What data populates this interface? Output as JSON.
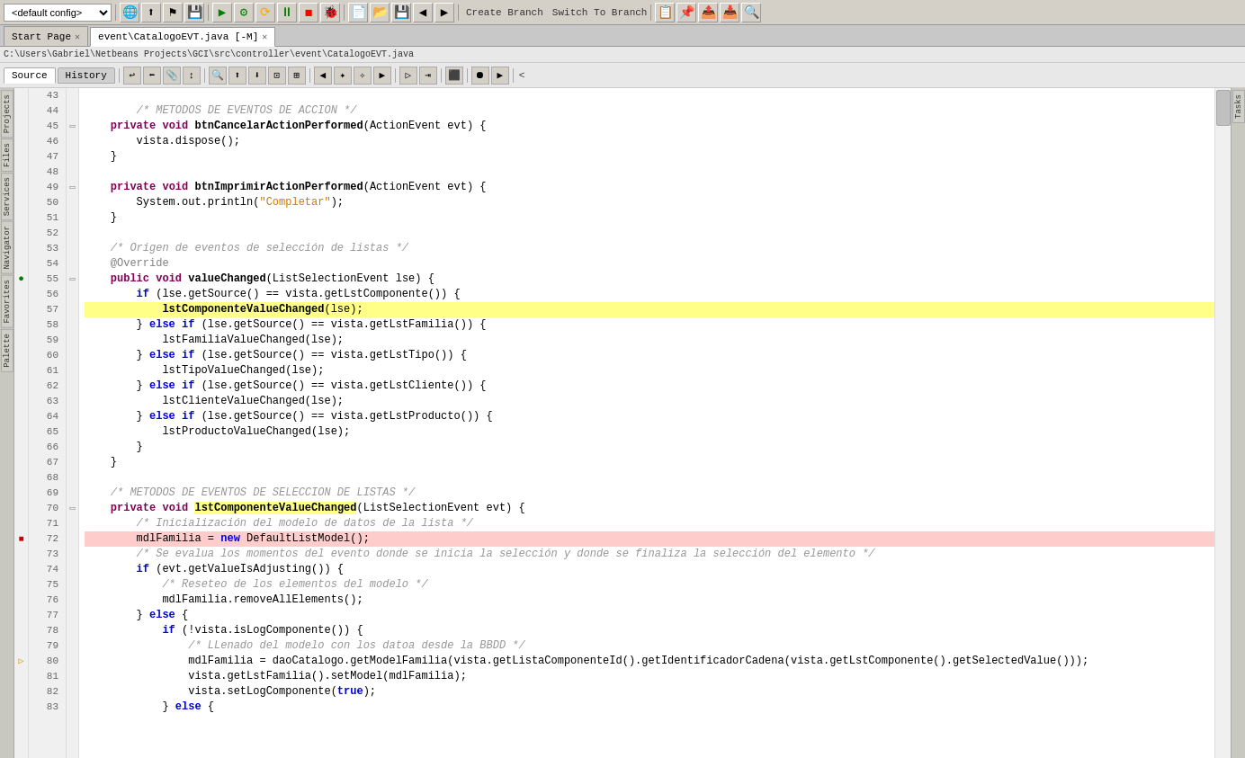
{
  "toolbar": {
    "config_dropdown": "<default config>",
    "buttons": [
      "globe",
      "↑",
      "⛳",
      "💾",
      "▶",
      "⬡",
      "⟳",
      "⏸",
      "◼",
      "📋",
      "📄",
      "💻",
      "📑",
      "🔧"
    ]
  },
  "tabs": [
    {
      "label": "Start Page",
      "active": false,
      "closeable": true
    },
    {
      "label": "event\\CatalogoEVT.java [-M]",
      "active": true,
      "closeable": true
    }
  ],
  "breadcrumb": "C:\\Users\\Gabriel\\Netbeans Projects\\GCI\\src\\controller\\event\\CatalogoEVT.java",
  "source_tabs": [
    {
      "label": "Source",
      "active": true
    },
    {
      "label": "History",
      "active": false
    }
  ],
  "vertical_tabs": [
    "Projects",
    "Files",
    "Services",
    "Navigator",
    "Favorites",
    "Palette"
  ],
  "lines": [
    {
      "num": 43,
      "fold": null,
      "bp": null,
      "content": "",
      "type": "blank"
    },
    {
      "num": 44,
      "fold": null,
      "bp": null,
      "content": "        /* METODOS DE EVENTOS DE ACCION */",
      "type": "comment"
    },
    {
      "num": 45,
      "fold": "[",
      "bp": null,
      "content": "    private void btnCancelarActionPerformed(ActionEvent evt) {",
      "type": "code"
    },
    {
      "num": 46,
      "fold": null,
      "bp": null,
      "content": "        vista.dispose();",
      "type": "code"
    },
    {
      "num": 47,
      "fold": null,
      "bp": null,
      "content": "    }",
      "type": "code"
    },
    {
      "num": 48,
      "fold": null,
      "bp": null,
      "content": "",
      "type": "blank"
    },
    {
      "num": 49,
      "fold": "[",
      "bp": null,
      "content": "    private void btnImprimirActionPerformed(ActionEvent evt) {",
      "type": "code"
    },
    {
      "num": 50,
      "fold": null,
      "bp": null,
      "content": "        System.out.println(\"Completar\");",
      "type": "code"
    },
    {
      "num": 51,
      "fold": null,
      "bp": null,
      "content": "    }",
      "type": "code"
    },
    {
      "num": 52,
      "fold": null,
      "bp": null,
      "content": "",
      "type": "blank"
    },
    {
      "num": 53,
      "fold": null,
      "bp": null,
      "content": "    /* Origen de eventos de selección de listas */",
      "type": "comment"
    },
    {
      "num": 54,
      "fold": null,
      "bp": null,
      "content": "    @Override",
      "type": "annotation"
    },
    {
      "num": 55,
      "fold": "[",
      "bp": "green",
      "content": "    public void valueChanged(ListSelectionEvent lse) {",
      "type": "code"
    },
    {
      "num": 56,
      "fold": null,
      "bp": null,
      "content": "        if (lse.getSource() == vista.getLstComponente()) {",
      "type": "code"
    },
    {
      "num": 57,
      "fold": null,
      "bp": null,
      "content": "            lstComponenteValueChanged(lse);",
      "type": "code-highlight"
    },
    {
      "num": 58,
      "fold": null,
      "bp": null,
      "content": "        } else if (lse.getSource() == vista.getLstFamilia()) {",
      "type": "code"
    },
    {
      "num": 59,
      "fold": null,
      "bp": null,
      "content": "            lstFamiliaValueChanged(lse);",
      "type": "code"
    },
    {
      "num": 60,
      "fold": null,
      "bp": null,
      "content": "        } else if (lse.getSource() == vista.getLstTipo()) {",
      "type": "code"
    },
    {
      "num": 61,
      "fold": null,
      "bp": null,
      "content": "            lstTipoValueChanged(lse);",
      "type": "code"
    },
    {
      "num": 62,
      "fold": null,
      "bp": null,
      "content": "        } else if (lse.getSource() == vista.getLstCliente()) {",
      "type": "code"
    },
    {
      "num": 63,
      "fold": null,
      "bp": null,
      "content": "            lstClienteValueChanged(lse);",
      "type": "code"
    },
    {
      "num": 64,
      "fold": null,
      "bp": null,
      "content": "        } else if (lse.getSource() == vista.getLstProducto()) {",
      "type": "code"
    },
    {
      "num": 65,
      "fold": null,
      "bp": null,
      "content": "            lstProductoValueChanged(lse);",
      "type": "code"
    },
    {
      "num": 66,
      "fold": null,
      "bp": null,
      "content": "        }",
      "type": "code"
    },
    {
      "num": 67,
      "fold": null,
      "bp": null,
      "content": "    }",
      "type": "code"
    },
    {
      "num": 68,
      "fold": null,
      "bp": null,
      "content": "",
      "type": "blank"
    },
    {
      "num": 69,
      "fold": null,
      "bp": null,
      "content": "    /* METODOS DE EVENTOS DE SELECCION DE LISTAS */",
      "type": "comment"
    },
    {
      "num": 70,
      "fold": "[",
      "bp": null,
      "content": "    private void lstComponenteValueChanged(ListSelectionEvent evt) {",
      "type": "code-method-highlight"
    },
    {
      "num": 71,
      "fold": null,
      "bp": null,
      "content": "        /* Inicialización del modelo de datos de la lista */",
      "type": "comment"
    },
    {
      "num": 72,
      "fold": null,
      "bp": "red-sq",
      "content": "        mdlFamilia = new DefaultListModel();",
      "type": "code-error"
    },
    {
      "num": 73,
      "fold": null,
      "bp": null,
      "content": "        /* Se evalua los momentos del evento donde se inicia la selección y donde se finaliza la selección del elemento */",
      "type": "comment"
    },
    {
      "num": 74,
      "fold": null,
      "bp": null,
      "content": "        if (evt.getValueIsAdjusting()) {",
      "type": "code"
    },
    {
      "num": 75,
      "fold": null,
      "bp": null,
      "content": "            /* Reseteo de los elementos del modelo */",
      "type": "comment"
    },
    {
      "num": 76,
      "fold": null,
      "bp": null,
      "content": "            mdlFamilia.removeAllElements();",
      "type": "code"
    },
    {
      "num": 77,
      "fold": null,
      "bp": null,
      "content": "        } else {",
      "type": "code"
    },
    {
      "num": 78,
      "fold": null,
      "bp": null,
      "content": "            if (!vista.isLogComponente()) {",
      "type": "code"
    },
    {
      "num": 79,
      "fold": null,
      "bp": null,
      "content": "                /* LLenado del modelo con los datoa desde la BBDD */",
      "type": "comment"
    },
    {
      "num": 80,
      "fold": null,
      "bp": "arrow",
      "content": "                mdlFamilia = daoCatalogo.getModelFamilia(vista.getListaComponenteId().getIdentificadorCadena(vista.getLstComponente().getSelectedValue()));",
      "type": "code"
    },
    {
      "num": 81,
      "fold": null,
      "bp": null,
      "content": "                vista.getLstFamilia().setModel(mdlFamilia);",
      "type": "code"
    },
    {
      "num": 82,
      "fold": null,
      "bp": null,
      "content": "                vista.setLogComponente(true);",
      "type": "code"
    },
    {
      "num": 83,
      "fold": null,
      "bp": null,
      "content": "            } else {",
      "type": "code"
    }
  ],
  "colors": {
    "error_line_bg": "#ffcccc",
    "highlight_bg": "#ffff88",
    "comment": "#969696",
    "keyword": "#0000e6",
    "string_color": "#ce7b00",
    "annotation_color": "#808080"
  }
}
